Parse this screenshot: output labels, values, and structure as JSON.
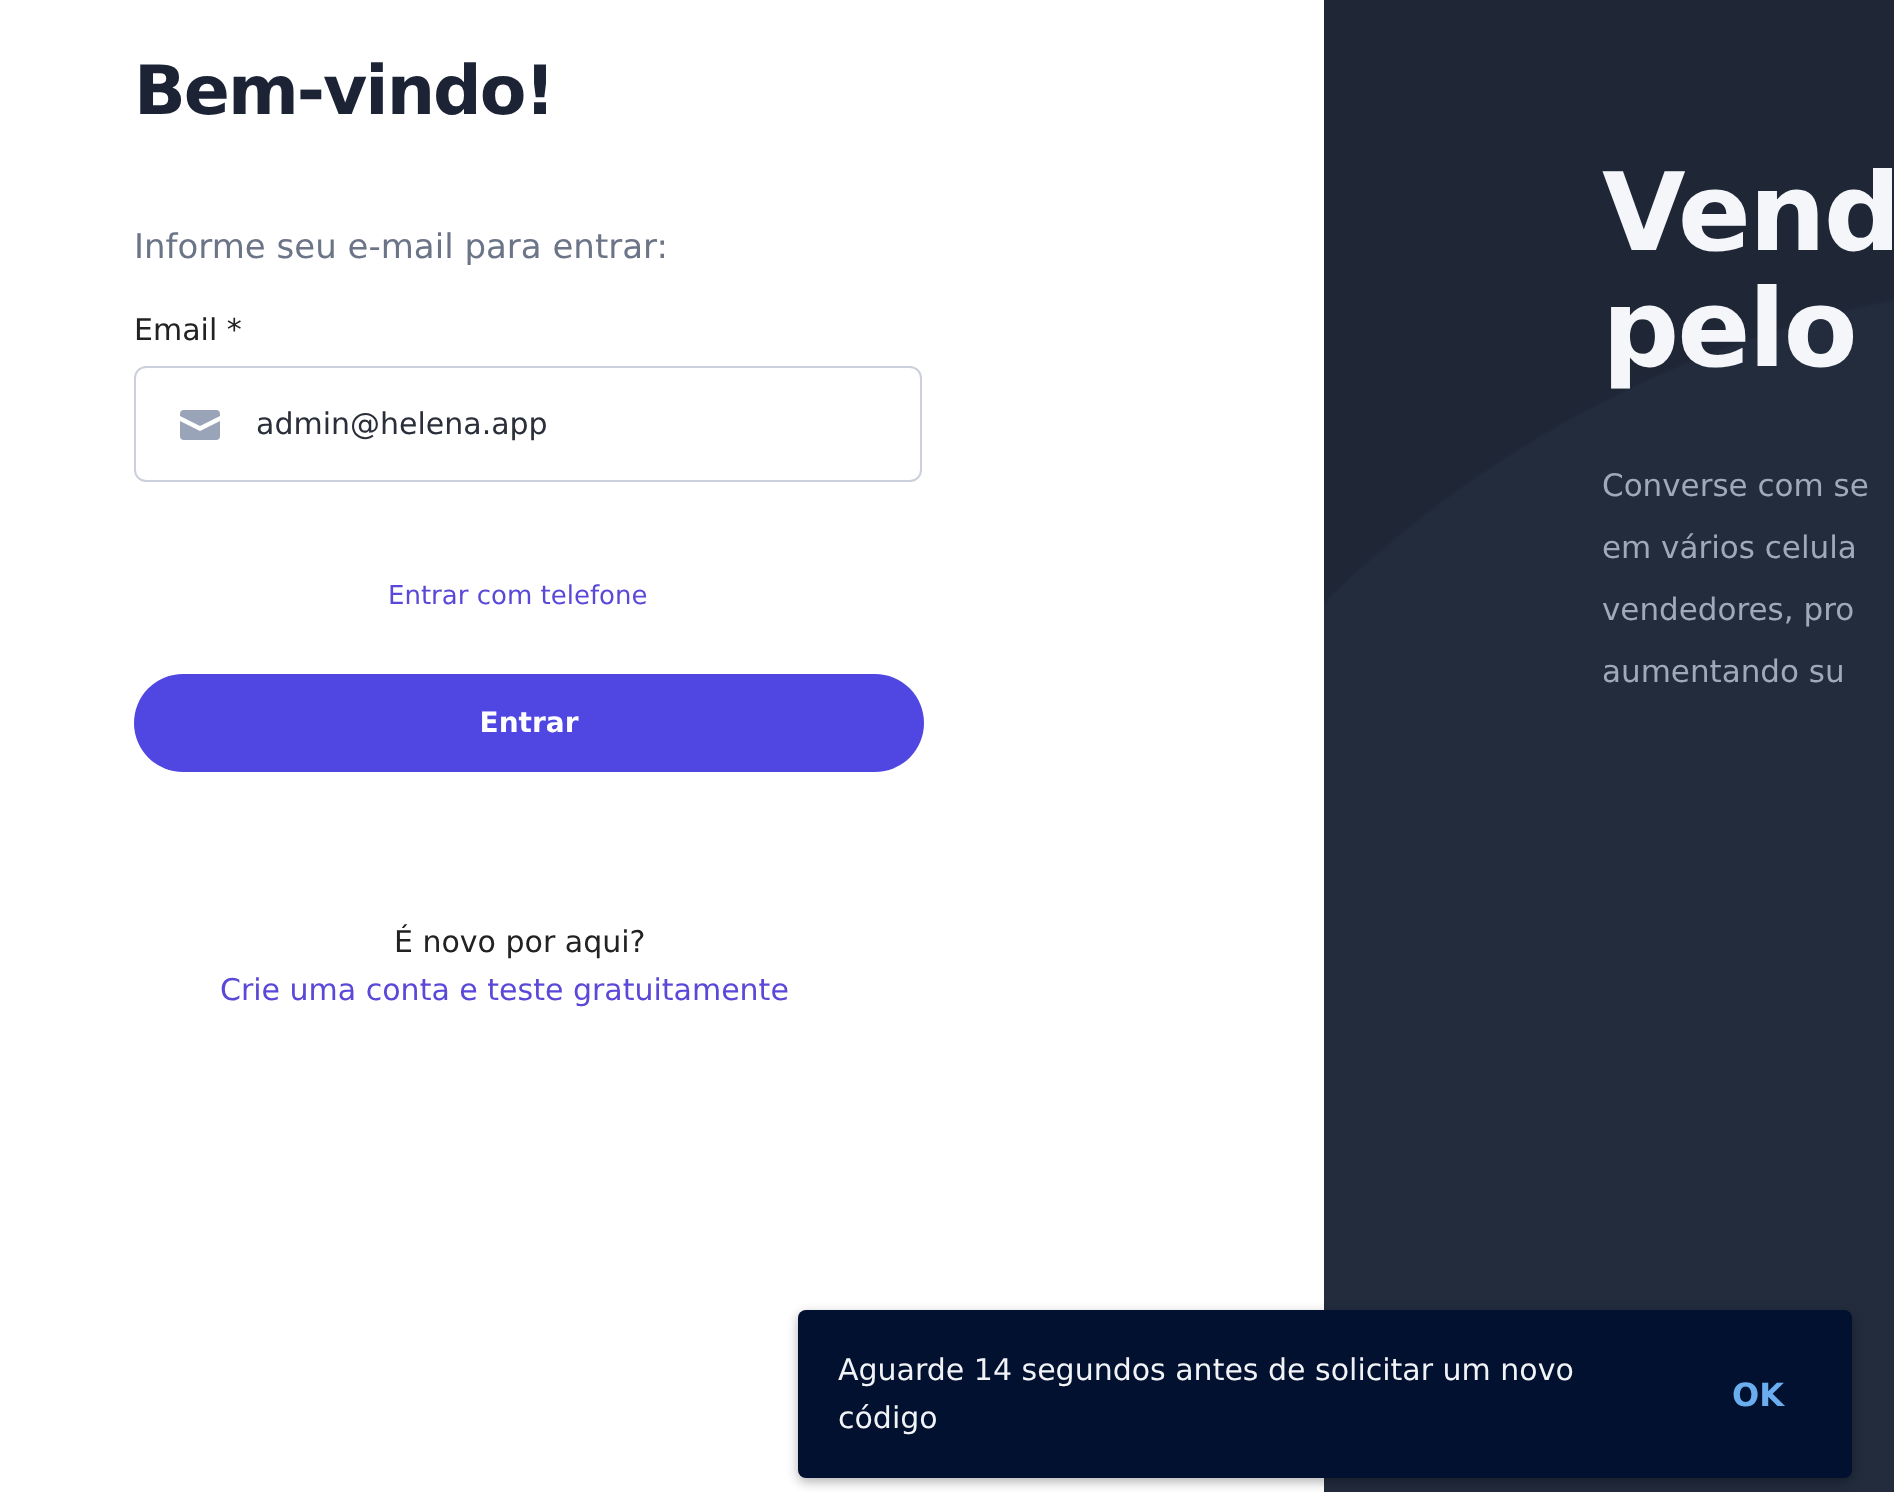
{
  "login": {
    "title": "Bem-vindo!",
    "subtitle": "Informe seu e-mail para entrar:",
    "email_label": "Email *",
    "email_value": "admin@helena.app",
    "phone_link": "Entrar com telefone",
    "submit": "Entrar",
    "signup_question": "É novo por aqui?",
    "signup_link": "Crie uma conta e teste gratuitamente"
  },
  "hero": {
    "title_lines": [
      "Vend",
      "pelo"
    ],
    "description_lines": [
      "Converse com se",
      "em vários celula",
      "vendedores, pro",
      "aumentando su"
    ]
  },
  "toast": {
    "message": "Aguarde 14 segundos antes de solicitar um novo código",
    "action": "OK"
  }
}
